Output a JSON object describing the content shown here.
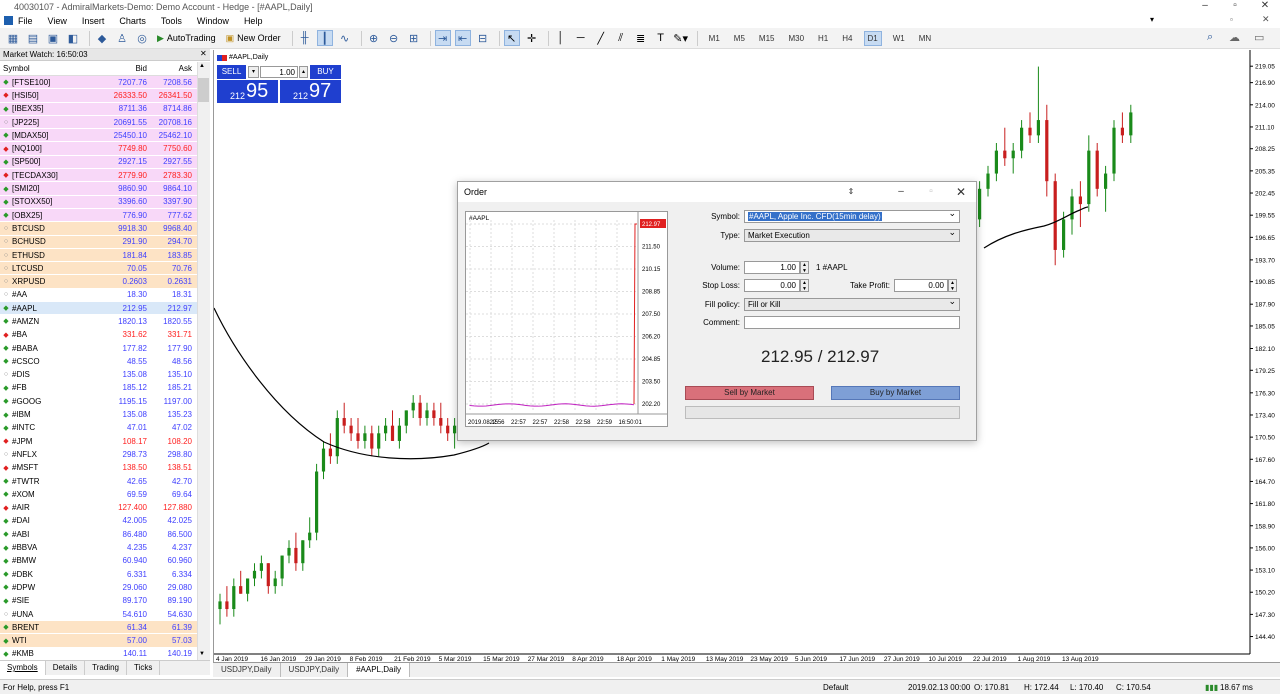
{
  "window": {
    "title": "40030107 - AdmiralMarkets-Demo: Demo Account - Hedge - [#AAPL,Daily]"
  },
  "menu": [
    "File",
    "View",
    "Insert",
    "Charts",
    "Tools",
    "Window",
    "Help"
  ],
  "toolbar": {
    "autotrading": "AutoTrading",
    "new_order": "New Order",
    "timeframes": [
      "M1",
      "M5",
      "M15",
      "M30",
      "H1",
      "H4",
      "D1",
      "W1",
      "MN"
    ],
    "active_tf": "D1"
  },
  "market_watch": {
    "header": "Market Watch: 16:50:03",
    "col_symbol": "Symbol",
    "col_bid": "Bid",
    "col_ask": "Ask",
    "rows": [
      {
        "s": "[FTSE100]",
        "b": "7207.76",
        "a": "7208.56",
        "c": "pink",
        "d": "up"
      },
      {
        "s": "[HSI50]",
        "b": "26333.50",
        "a": "26341.50",
        "c": "pink",
        "d": "dn"
      },
      {
        "s": "[IBEX35]",
        "b": "8711.36",
        "a": "8714.86",
        "c": "pink",
        "d": "up"
      },
      {
        "s": "[JP225]",
        "b": "20691.55",
        "a": "20708.16",
        "c": "pink",
        "d": "o"
      },
      {
        "s": "[MDAX50]",
        "b": "25450.10",
        "a": "25462.10",
        "c": "pink",
        "d": "up"
      },
      {
        "s": "[NQ100]",
        "b": "7749.80",
        "a": "7750.60",
        "c": "pink",
        "d": "dn"
      },
      {
        "s": "[SP500]",
        "b": "2927.15",
        "a": "2927.55",
        "c": "pink",
        "d": "up"
      },
      {
        "s": "[TECDAX30]",
        "b": "2779.90",
        "a": "2783.30",
        "c": "pink",
        "d": "dn"
      },
      {
        "s": "[SMI20]",
        "b": "9860.90",
        "a": "9864.10",
        "c": "pink",
        "d": "up"
      },
      {
        "s": "[STOXX50]",
        "b": "3396.60",
        "a": "3397.90",
        "c": "pink",
        "d": "up"
      },
      {
        "s": "[OBX25]",
        "b": "776.90",
        "a": "777.62",
        "c": "pink",
        "d": "up"
      },
      {
        "s": "BTCUSD",
        "b": "9918.30",
        "a": "9968.40",
        "c": "orange",
        "d": "o"
      },
      {
        "s": "BCHUSD",
        "b": "291.90",
        "a": "294.70",
        "c": "orange",
        "d": "o"
      },
      {
        "s": "ETHUSD",
        "b": "181.84",
        "a": "183.85",
        "c": "orange",
        "d": "o"
      },
      {
        "s": "LTCUSD",
        "b": "70.05",
        "a": "70.76",
        "c": "orange",
        "d": "o"
      },
      {
        "s": "XRPUSD",
        "b": "0.2603",
        "a": "0.2631",
        "c": "orange",
        "d": "o"
      },
      {
        "s": "#AA",
        "b": "18.30",
        "a": "18.31",
        "c": "",
        "d": "o"
      },
      {
        "s": "#AAPL",
        "b": "212.95",
        "a": "212.97",
        "c": "sel",
        "d": "up"
      },
      {
        "s": "#AMZN",
        "b": "1820.13",
        "a": "1820.55",
        "c": "",
        "d": "up"
      },
      {
        "s": "#BA",
        "b": "331.62",
        "a": "331.71",
        "c": "",
        "d": "dn"
      },
      {
        "s": "#BABA",
        "b": "177.82",
        "a": "177.90",
        "c": "",
        "d": "up"
      },
      {
        "s": "#CSCO",
        "b": "48.55",
        "a": "48.56",
        "c": "",
        "d": "up"
      },
      {
        "s": "#DIS",
        "b": "135.08",
        "a": "135.10",
        "c": "",
        "d": "o"
      },
      {
        "s": "#FB",
        "b": "185.12",
        "a": "185.21",
        "c": "",
        "d": "up"
      },
      {
        "s": "#GOOG",
        "b": "1195.15",
        "a": "1197.00",
        "c": "",
        "d": "up"
      },
      {
        "s": "#IBM",
        "b": "135.08",
        "a": "135.23",
        "c": "",
        "d": "up"
      },
      {
        "s": "#INTC",
        "b": "47.01",
        "a": "47.02",
        "c": "",
        "d": "up"
      },
      {
        "s": "#JPM",
        "b": "108.17",
        "a": "108.20",
        "c": "",
        "d": "dn"
      },
      {
        "s": "#NFLX",
        "b": "298.73",
        "a": "298.80",
        "c": "",
        "d": "o"
      },
      {
        "s": "#MSFT",
        "b": "138.50",
        "a": "138.51",
        "c": "",
        "d": "dn"
      },
      {
        "s": "#TWTR",
        "b": "42.65",
        "a": "42.70",
        "c": "",
        "d": "up"
      },
      {
        "s": "#XOM",
        "b": "69.59",
        "a": "69.64",
        "c": "",
        "d": "up"
      },
      {
        "s": "#AIR",
        "b": "127.400",
        "a": "127.880",
        "c": "",
        "d": "dn"
      },
      {
        "s": "#DAI",
        "b": "42.005",
        "a": "42.025",
        "c": "",
        "d": "up"
      },
      {
        "s": "#ABI",
        "b": "86.480",
        "a": "86.500",
        "c": "",
        "d": "up"
      },
      {
        "s": "#BBVA",
        "b": "4.235",
        "a": "4.237",
        "c": "",
        "d": "up"
      },
      {
        "s": "#BMW",
        "b": "60.940",
        "a": "60.960",
        "c": "",
        "d": "up"
      },
      {
        "s": "#DBK",
        "b": "6.331",
        "a": "6.334",
        "c": "",
        "d": "up"
      },
      {
        "s": "#DPW",
        "b": "29.060",
        "a": "29.080",
        "c": "",
        "d": "up"
      },
      {
        "s": "#SIE",
        "b": "89.170",
        "a": "89.190",
        "c": "",
        "d": "up"
      },
      {
        "s": "#UNA",
        "b": "54.610",
        "a": "54.630",
        "c": "",
        "d": "o"
      },
      {
        "s": "BRENT",
        "b": "61.34",
        "a": "61.39",
        "c": "orange",
        "d": "up"
      },
      {
        "s": "WTI",
        "b": "57.00",
        "a": "57.03",
        "c": "orange",
        "d": "up"
      },
      {
        "s": "#KMB",
        "b": "140.11",
        "a": "140.19",
        "c": "",
        "d": "up"
      }
    ],
    "tabs": [
      "Symbols",
      "Details",
      "Trading",
      "Ticks"
    ]
  },
  "one_click": {
    "sell": "SELL",
    "buy": "BUY",
    "volume": "1.00",
    "sell_small": "212",
    "sell_big": "95",
    "buy_small": "212",
    "buy_big": "97"
  },
  "chart_label": "#AAPL,Daily",
  "chart_data": {
    "type": "candlestick",
    "y_ticks": [
      "219.05",
      "216.90",
      "214.00",
      "211.10",
      "208.25",
      "205.35",
      "202.45",
      "199.55",
      "196.65",
      "193.70",
      "190.85",
      "187.90",
      "185.05",
      "182.10",
      "179.25",
      "176.30",
      "173.40",
      "170.50",
      "167.60",
      "164.70",
      "161.80",
      "158.90",
      "156.00",
      "153.10",
      "150.20",
      "147.30",
      "144.40"
    ],
    "x_ticks": [
      "4 Jan 2019",
      "16 Jan 2019",
      "29 Jan 2019",
      "8 Feb 2019",
      "21 Feb 2019",
      "5 Mar 2019",
      "15 Mar 2019",
      "27 Mar 2019",
      "8 Apr 2019",
      "18 Apr 2019",
      "1 May 2019",
      "13 May 2019",
      "23 May 2019",
      "5 Jun 2019",
      "17 Jun 2019",
      "27 Jun 2019",
      "10 Jul 2019",
      "22 Jul 2019",
      "1 Aug 2019",
      "13 Aug 2019"
    ],
    "candles_left": [
      [
        148,
        150,
        146,
        149
      ],
      [
        149,
        151,
        147,
        148
      ],
      [
        148,
        152,
        147,
        151
      ],
      [
        151,
        153,
        150,
        150
      ],
      [
        150,
        152,
        149,
        152
      ],
      [
        152,
        154,
        151,
        153
      ],
      [
        153,
        155,
        152,
        154
      ],
      [
        154,
        154,
        150,
        151
      ],
      [
        151,
        153,
        150,
        152
      ],
      [
        152,
        155,
        151,
        155
      ],
      [
        155,
        157,
        154,
        156
      ],
      [
        156,
        158,
        153,
        154
      ],
      [
        154,
        157,
        153,
        157
      ],
      [
        157,
        160,
        156,
        158
      ],
      [
        158,
        167,
        157,
        166
      ],
      [
        166,
        170,
        165,
        169
      ],
      [
        169,
        171,
        167,
        168
      ],
      [
        168,
        174,
        167,
        173
      ],
      [
        173,
        175,
        171,
        172
      ],
      [
        172,
        173,
        170,
        171
      ],
      [
        171,
        173,
        169,
        170
      ],
      [
        170,
        172,
        169,
        171
      ],
      [
        171,
        172,
        168,
        169
      ],
      [
        169,
        172,
        168,
        171
      ],
      [
        171,
        173,
        170,
        172
      ],
      [
        172,
        174,
        170,
        170
      ],
      [
        170,
        173,
        169,
        172
      ],
      [
        172,
        174,
        171,
        174
      ],
      [
        174,
        176,
        173,
        175
      ],
      [
        175,
        176,
        172,
        173
      ],
      [
        173,
        175,
        172,
        174
      ],
      [
        174,
        175,
        172,
        173
      ],
      [
        173,
        175,
        171,
        172
      ],
      [
        172,
        173,
        170,
        171
      ],
      [
        171,
        173,
        169,
        172
      ]
    ],
    "candles_right": [
      [
        198,
        200,
        194,
        195
      ],
      [
        195,
        199,
        193,
        198
      ],
      [
        198,
        202,
        197,
        201
      ],
      [
        201,
        203,
        198,
        199
      ],
      [
        199,
        204,
        198,
        203
      ],
      [
        203,
        206,
        202,
        205
      ],
      [
        205,
        209,
        204,
        208
      ],
      [
        208,
        211,
        206,
        207
      ],
      [
        207,
        209,
        205,
        208
      ],
      [
        208,
        212,
        207,
        211
      ],
      [
        211,
        213,
        209,
        210
      ],
      [
        210,
        219,
        209,
        212
      ],
      [
        212,
        214,
        202,
        204
      ],
      [
        204,
        205,
        193,
        195
      ],
      [
        195,
        200,
        194,
        199
      ],
      [
        199,
        203,
        197,
        202
      ],
      [
        202,
        204,
        198,
        201
      ],
      [
        201,
        210,
        200,
        208
      ],
      [
        208,
        209,
        202,
        203
      ],
      [
        203,
        206,
        200,
        205
      ],
      [
        205,
        212,
        204,
        211
      ],
      [
        211,
        213,
        209,
        210
      ],
      [
        210,
        214,
        209,
        213
      ]
    ],
    "ma_note": ""
  },
  "chart_tabs": [
    "USDJPY,Daily",
    "USDJPY,Daily",
    "#AAPL,Daily"
  ],
  "status": {
    "help": "For Help, press F1",
    "profile": "Default",
    "datetime": "2019.02.13 00:00",
    "open": "O: 170.81",
    "high": "H: 172.44",
    "low": "L: 170.40",
    "close": "C: 170.54",
    "traffic": "18.67 ms"
  },
  "order": {
    "title": "Order",
    "mini_symbol": "#AAPL",
    "mini_y": [
      "212.97",
      "211.50",
      "210.15",
      "208.85",
      "207.50",
      "206.20",
      "204.85",
      "203.50",
      "202.20"
    ],
    "mini_x": [
      "2019.08.15",
      "22:56",
      "22:57",
      "22:57",
      "22:58",
      "22:58",
      "22:59",
      "16:50:01"
    ],
    "symbol_label": "Symbol:",
    "symbol_value": "#AAPL, Apple Inc. CFD(15min delay)",
    "type_label": "Type:",
    "type_value": "Market Execution",
    "volume_label": "Volume:",
    "volume_value": "1.00",
    "volume_unit": "1 #AAPL",
    "sl_label": "Stop Loss:",
    "sl_value": "0.00",
    "tp_label": "Take Profit:",
    "tp_value": "0.00",
    "fill_label": "Fill policy:",
    "fill_value": "Fill or Kill",
    "comment_label": "Comment:",
    "comment_value": "",
    "price": "212.95 / 212.97",
    "sell_btn": "Sell by Market",
    "buy_btn": "Buy by Market"
  },
  "colors": {
    "bull": "#1a8a1a",
    "bear": "#c81e1e",
    "accent": "#1f3fcf"
  }
}
